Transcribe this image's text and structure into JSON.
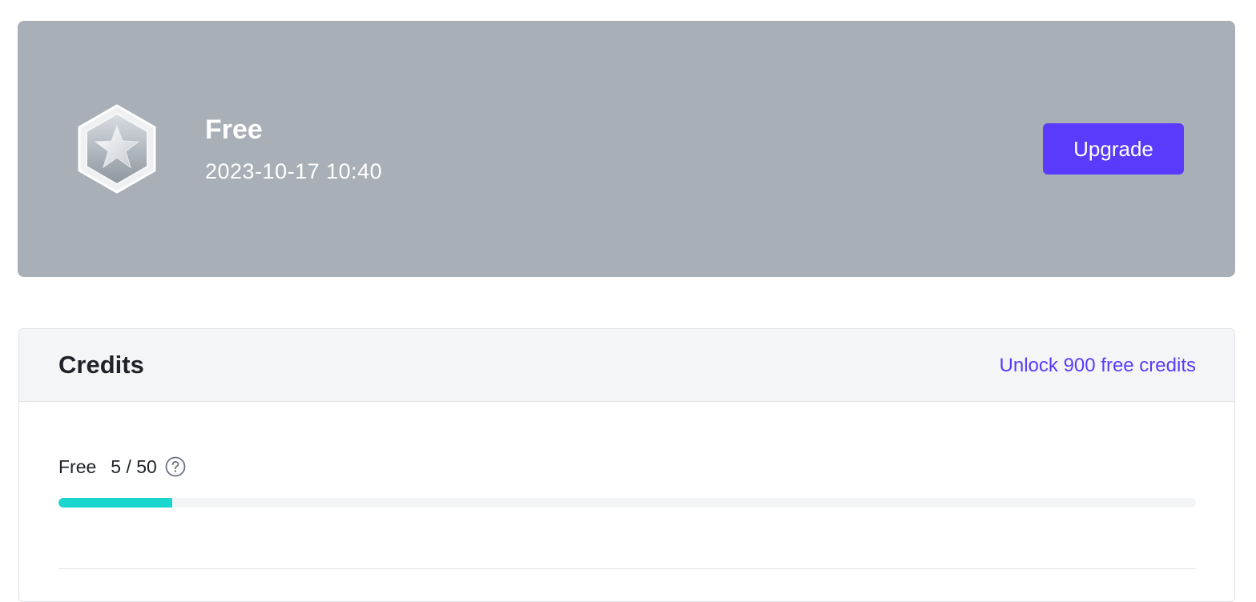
{
  "plan": {
    "name": "Free",
    "date": "2023-10-17 10:40",
    "badge_icon": "star-badge-icon",
    "upgrade_label": "Upgrade",
    "banner_color": "#a8afb6",
    "accent_color": "#5b3bfb"
  },
  "credits": {
    "title": "Credits",
    "unlock_label": "Unlock 900 free credits",
    "free": {
      "label": "Free",
      "count": "5 / 50",
      "used": 5,
      "total": 50,
      "progress_fraction": 0.1,
      "progress_color": "#19d6cf",
      "help_icon": "question-circle-icon"
    }
  }
}
